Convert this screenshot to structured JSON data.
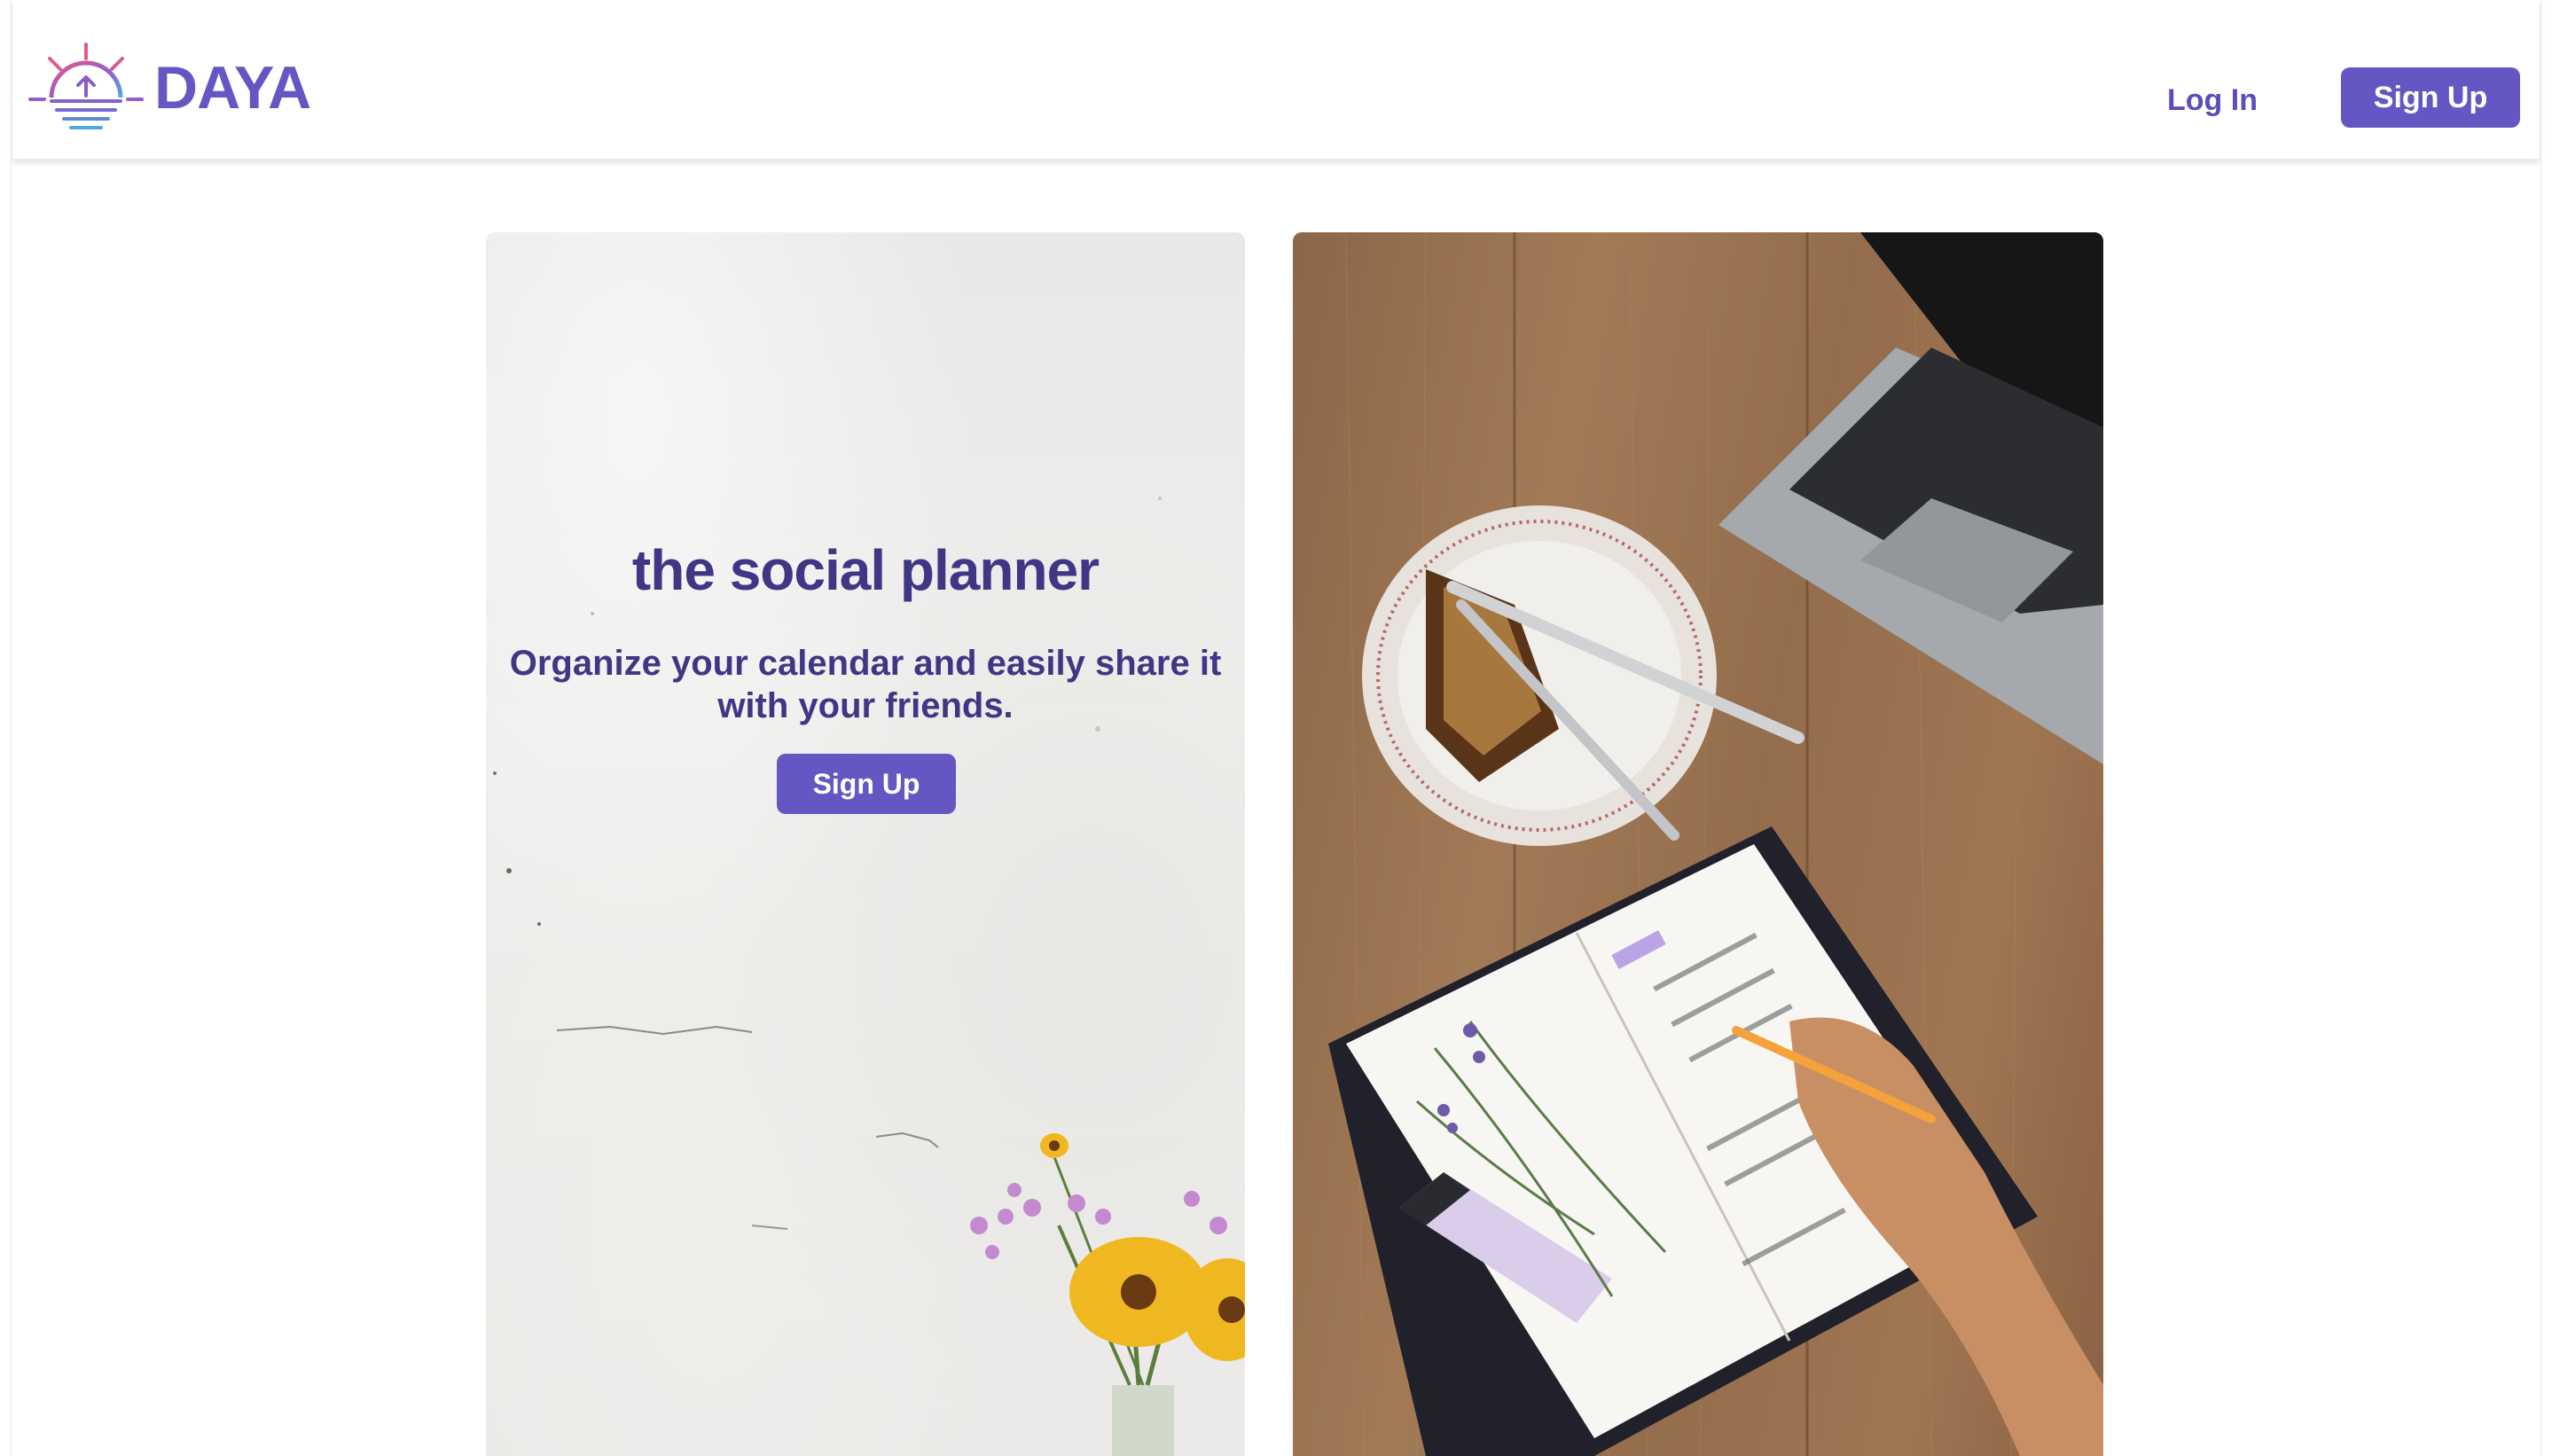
{
  "brand": {
    "name": "DAYA"
  },
  "nav": {
    "login_label": "Log In",
    "signup_label": "Sign Up"
  },
  "hero": {
    "title": "the social planner",
    "subtitle": "Organize your calendar and easily share it with your friends.",
    "cta_label": "Sign Up"
  },
  "colors": {
    "accent": "#6457c4",
    "heading": "#3f3785"
  },
  "images": {
    "left": "white-wall-with-flowers-photo",
    "right": "desk-with-laptop-planner-photo"
  }
}
